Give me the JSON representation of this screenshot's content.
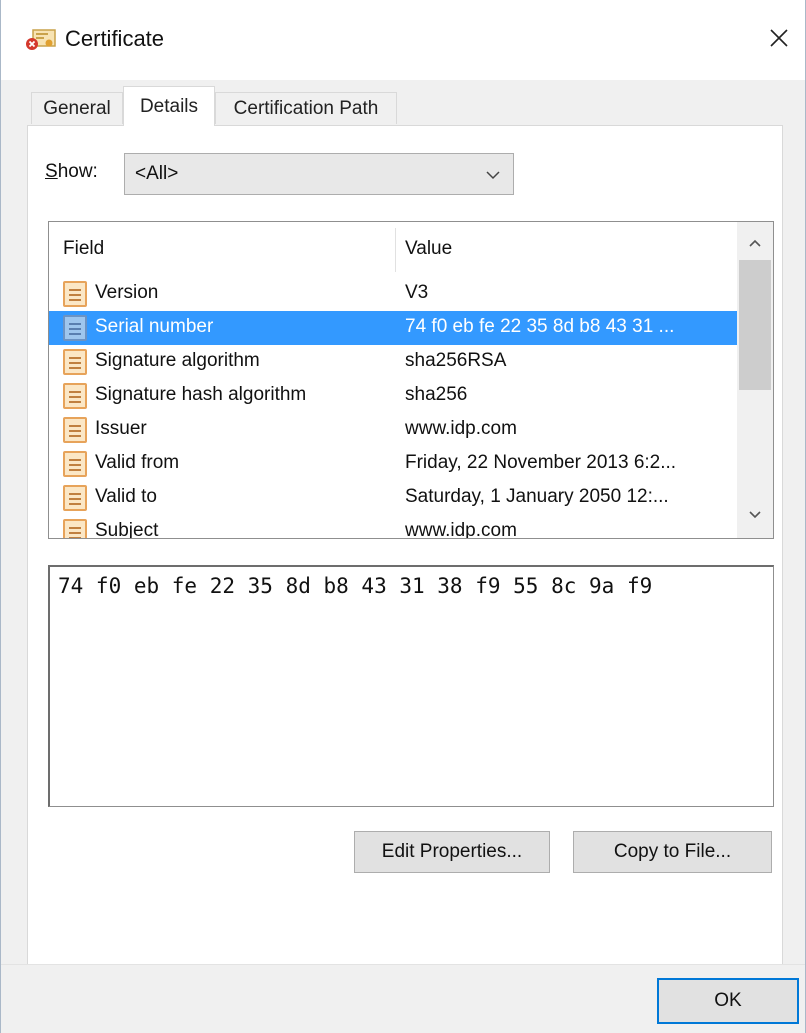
{
  "window": {
    "title": "Certificate",
    "icon": "certificate-error-icon",
    "close_glyph": "✕"
  },
  "tabs": [
    {
      "label": "General",
      "active": false
    },
    {
      "label": "Details",
      "active": true
    },
    {
      "label": "Certification Path",
      "active": false
    }
  ],
  "show": {
    "label_prefix": "S",
    "label_rest": "how:",
    "selected": "<All>"
  },
  "list": {
    "columns": {
      "field": "Field",
      "value": "Value"
    },
    "rows": [
      {
        "field": "Version",
        "value": "V3",
        "selected": false
      },
      {
        "field": "Serial number",
        "value": "74 f0 eb fe 22 35 8d b8 43 31 ...",
        "selected": true
      },
      {
        "field": "Signature algorithm",
        "value": "sha256RSA",
        "selected": false
      },
      {
        "field": "Signature hash algorithm",
        "value": "sha256",
        "selected": false
      },
      {
        "field": "Issuer",
        "value": "www.idp.com",
        "selected": false
      },
      {
        "field": "Valid from",
        "value": "Friday, 22 November 2013 6:2...",
        "selected": false
      },
      {
        "field": "Valid to",
        "value": "Saturday, 1 January 2050 12:...",
        "selected": false
      },
      {
        "field": "Subject",
        "value": "www.idp.com",
        "selected": false
      }
    ]
  },
  "detail_text": "74 f0 eb fe 22 35 8d b8 43 31 38 f9 55 8c 9a f9",
  "buttons": {
    "edit_properties": "Edit Properties...",
    "copy_to_file": "Copy to File...",
    "ok": "OK"
  },
  "colors": {
    "selection": "#3399ff",
    "default_button_border": "#0078d7"
  }
}
